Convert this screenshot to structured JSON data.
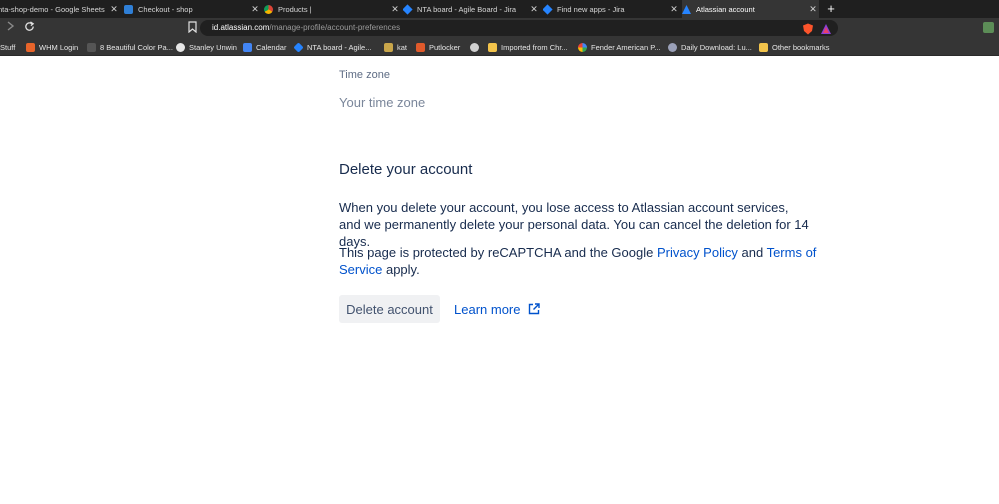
{
  "browser": {
    "tabs": [
      {
        "label": "nta-shop-demo - Google Sheets",
        "close": "✕"
      },
      {
        "label": "Checkout - shop",
        "close": "✕"
      },
      {
        "label": "Products |",
        "close": "✕"
      },
      {
        "label": "NTA board - Agile Board - Jira",
        "close": "✕"
      },
      {
        "label": "Find new apps - Jira",
        "close": "✕"
      },
      {
        "label": "Atlassian account",
        "close": "✕"
      }
    ],
    "new_tab": "+",
    "url": {
      "domain": "id.atlassian.com",
      "path": "/manage-profile/account-preferences"
    },
    "bookmarks": [
      {
        "label": "Stuff"
      },
      {
        "label": "WHM Login"
      },
      {
        "label": "8 Beautiful Color Pa..."
      },
      {
        "label": "Stanley Unwin"
      },
      {
        "label": "Calendar"
      },
      {
        "label": "NTA board - Agile..."
      },
      {
        "label": "kat"
      },
      {
        "label": "Putlocker"
      },
      {
        "label": ""
      },
      {
        "label": "Imported from Chr..."
      },
      {
        "label": "Fender American P..."
      },
      {
        "label": "Daily Download: Lu..."
      },
      {
        "label": "Other bookmarks"
      }
    ],
    "colors": {
      "frame": "#1f1f1f",
      "toolbar": "#353535",
      "omnibox": "#202020"
    }
  },
  "page": {
    "time_zone_label": "Time zone",
    "time_zone_value": "Your time zone",
    "delete_heading": "Delete your account",
    "delete_description": "When you delete your account, you lose access to Atlassian account services, and we permanently delete your personal data. You can cancel the deletion for 14 days.",
    "recaptcha": {
      "prefix": "This page is protected by reCAPTCHA and the Google ",
      "privacy_link": "Privacy Policy",
      "middle": " and ",
      "terms_link": "Terms of Service",
      "suffix": " apply."
    },
    "delete_button": "Delete account",
    "learn_more": "Learn more",
    "colors": {
      "text": "#172b4d",
      "link": "#0052cc",
      "subtle": "#7a869a"
    }
  }
}
